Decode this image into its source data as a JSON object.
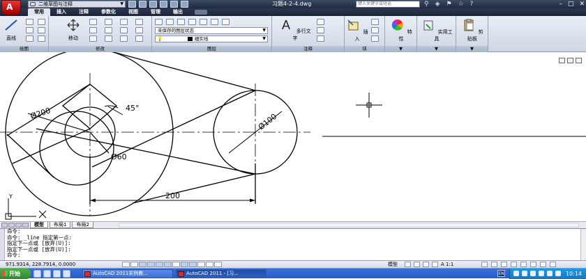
{
  "title_bar": {
    "workspace": "二维草图与注释",
    "document_title": "习题4-2-4.dwg",
    "search_placeholder": "键入关键字或短语",
    "app_menu_letter": "A"
  },
  "ribbon_tabs": [
    "常用",
    "插入",
    "注释",
    "参数化",
    "视图",
    "管理",
    "输出"
  ],
  "ribbon": {
    "draw": {
      "label": "绘图",
      "line": "直线"
    },
    "modify": {
      "label": "修改",
      "move": "移动"
    },
    "layers": {
      "label": "图层",
      "layer_state": "未保存的图层状态",
      "linetype": "细实线"
    },
    "annotation": {
      "label": "注释",
      "mtext": "多行文字"
    },
    "block": {
      "label": "块",
      "insert": "插入"
    },
    "properties": {
      "label": "特性"
    },
    "utilities": {
      "label": "实用工具"
    },
    "clipboard": {
      "label": "剪贴板"
    }
  },
  "drawing": {
    "dim_angle": "45°",
    "dim_d200": "Ø200",
    "dim_d100": "Ø100",
    "dim_d60": "Ø60",
    "dim_len": "200",
    "ucs_y": "Y",
    "ucs_x": "X"
  },
  "layout_tabs": [
    "模型",
    "布局1",
    "布局2"
  ],
  "command_lines": [
    "命令:",
    "命令: _line 指定第一点:",
    "指定下一点或 [放弃(U)]:",
    "指定下一点或 [放弃(U)]:",
    "命令:"
  ],
  "status_bar": {
    "coords": "971.9314, 228.7914, 0.0000",
    "model": "模型",
    "scale": "A 1:1"
  },
  "taskbar": {
    "start": "开始",
    "tasks": [
      "AutoCAD 2011实例教...",
      "AutoCAD 2011 - [习..."
    ],
    "lang": "EN",
    "clock": "10:14"
  }
}
